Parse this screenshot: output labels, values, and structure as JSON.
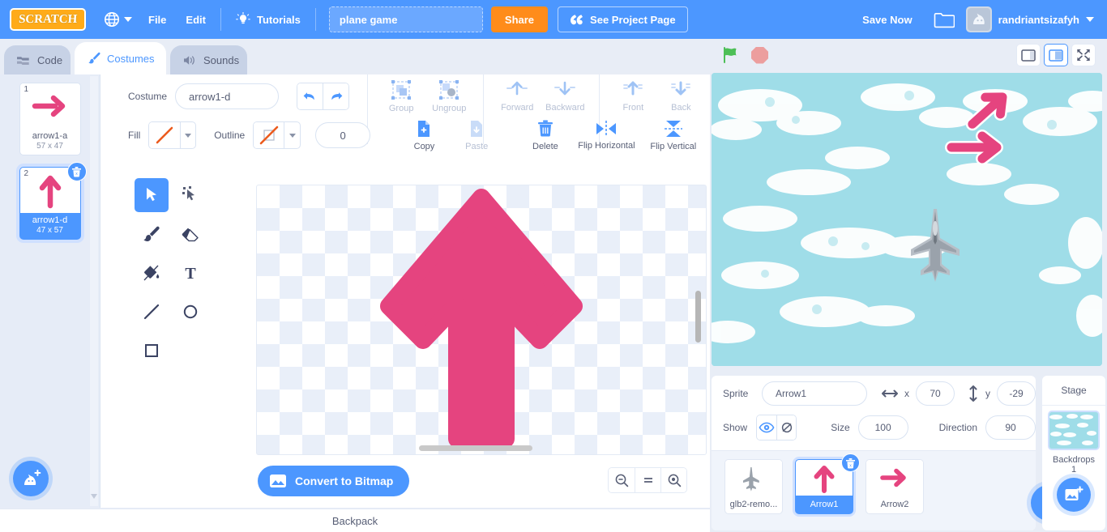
{
  "menubar": {
    "logo_text": "SCRATCH",
    "globe_icon": "globe-icon",
    "file_label": "File",
    "edit_label": "Edit",
    "tutorials_label": "Tutorials",
    "tutorials_icon": "lightbulb-icon",
    "project_name": "plane game",
    "project_name_placeholder": "Project title",
    "share_label": "Share",
    "project_page_label": "See Project Page",
    "project_page_icon": "quote-icon",
    "save_now_label": "Save Now",
    "folder_icon": "folder-icon",
    "avatar_icon": "cat-avatar-icon",
    "username": "randriantsizafyh",
    "accent_blue": "#4c97ff",
    "accent_orange": "#ff8c1a"
  },
  "tabs": [
    {
      "label": "Code",
      "icon": "code-blocks-icon",
      "active": false
    },
    {
      "label": "Costumes",
      "icon": "paintbrush-icon",
      "active": true
    },
    {
      "label": "Sounds",
      "icon": "speaker-icon",
      "active": false
    }
  ],
  "costume_list": {
    "items": [
      {
        "number": "1",
        "name": "arrow1-a",
        "size": "57 x 47",
        "selected": false,
        "direction": "right"
      },
      {
        "number": "2",
        "name": "arrow1-d",
        "size": "47 x 57",
        "selected": true,
        "direction": "up"
      }
    ],
    "add_button_icon": "add-costume-cat-icon",
    "delete_badge_icon": "trash-icon"
  },
  "paint_editor": {
    "costume_label": "Costume",
    "costume_name": "arrow1-d",
    "costume_name_placeholder": "name",
    "undo_icon": "undo-icon",
    "redo_icon": "redo-icon",
    "fill_label": "Fill",
    "outline_label": "Outline",
    "stroke_width": "0",
    "row1_buttons": [
      {
        "label": "Group",
        "icon": "group-icon",
        "enabled": false
      },
      {
        "label": "Ungroup",
        "icon": "ungroup-icon",
        "enabled": false
      },
      {
        "label": "Forward",
        "icon": "forward-icon",
        "enabled": false
      },
      {
        "label": "Backward",
        "icon": "backward-icon",
        "enabled": false
      },
      {
        "label": "Front",
        "icon": "front-icon",
        "enabled": false
      },
      {
        "label": "Back",
        "icon": "back-icon",
        "enabled": false
      }
    ],
    "row2_buttons": [
      {
        "label": "Copy",
        "icon": "copy-icon",
        "enabled": true
      },
      {
        "label": "Paste",
        "icon": "paste-icon",
        "enabled": false
      },
      {
        "label": "Delete",
        "icon": "trash-icon",
        "enabled": true
      },
      {
        "label": "Flip Horizontal",
        "icon": "flip-horizontal-icon",
        "enabled": true
      },
      {
        "label": "Flip Vertical",
        "icon": "flip-vertical-icon",
        "enabled": true
      }
    ],
    "tools": [
      {
        "name": "select-tool",
        "icon": "cursor-arrow-icon",
        "active": true
      },
      {
        "name": "reshape-tool",
        "icon": "reshape-node-icon",
        "active": false
      },
      {
        "name": "brush-tool",
        "icon": "paintbrush-icon",
        "active": false
      },
      {
        "name": "eraser-tool",
        "icon": "eraser-icon",
        "active": false
      },
      {
        "name": "fill-tool",
        "icon": "paint-bucket-icon",
        "active": false
      },
      {
        "name": "text-tool",
        "icon": "text-T-icon",
        "active": false
      },
      {
        "name": "line-tool",
        "icon": "line-icon",
        "active": false
      },
      {
        "name": "circle-tool",
        "icon": "circle-icon",
        "active": false
      },
      {
        "name": "rectangle-tool",
        "icon": "rectangle-icon",
        "active": false
      }
    ],
    "convert_label": "Convert to Bitmap",
    "convert_icon": "image-icon",
    "zoom_out_label": "zoom-out-icon",
    "zoom_reset_label": "zoom-reset-icon",
    "zoom_in_label": "zoom-in-icon",
    "canvas_shape_color": "#e5447f"
  },
  "stage_controls": {
    "green_flag_icon": "green-flag-icon",
    "stop_icon": "stop-sign-icon",
    "small_stage_icon": "small-stage-icon",
    "large_stage_icon": "large-stage-icon",
    "fullscreen_icon": "fullscreen-icon"
  },
  "stage": {
    "backdrop_color": "#9fdde8",
    "sprites_on_stage": [
      {
        "name": "Arrow2",
        "shape": "right-arrow",
        "color": "#e5447f"
      },
      {
        "name": "Arrow1",
        "shape": "right-arrow",
        "color": "#e5447f"
      },
      {
        "name": "glb2-remo...",
        "shape": "jet-plane",
        "color": "#9aa2ab"
      }
    ]
  },
  "sprite_info": {
    "sprite_label": "Sprite",
    "sprite_name": "Arrow1",
    "sprite_name_placeholder": "name",
    "x_label": "x",
    "x_value": "70",
    "y_label": "y",
    "y_value": "-29",
    "show_label": "Show",
    "show_on_icon": "eye-open-icon",
    "show_off_icon": "eye-closed-icon",
    "size_label": "Size",
    "size_value": "100",
    "direction_label": "Direction",
    "direction_value": "90"
  },
  "sprite_list": {
    "items": [
      {
        "name": "glb2-remo...",
        "selected": false,
        "thumb": "jet-plane"
      },
      {
        "name": "Arrow1",
        "selected": true,
        "thumb": "up-arrow"
      },
      {
        "name": "Arrow2",
        "selected": false,
        "thumb": "right-arrow"
      }
    ],
    "add_sprite_icon": "add-sprite-cat-icon",
    "delete_badge_icon": "trash-icon"
  },
  "stage_panel": {
    "title": "Stage",
    "backdrops_label": "Backdrops",
    "backdrops_count": "1",
    "add_backdrop_icon": "add-backdrop-image-icon"
  },
  "backpack": {
    "label": "Backpack"
  }
}
